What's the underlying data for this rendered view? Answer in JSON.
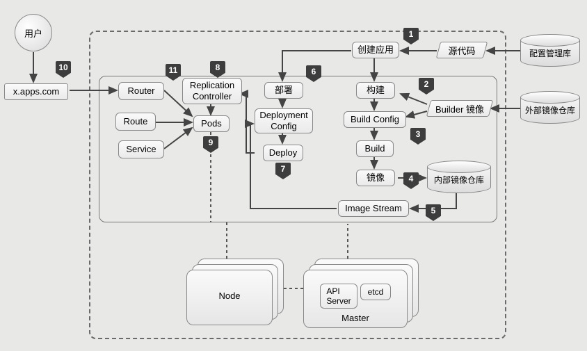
{
  "user": {
    "label": "用户"
  },
  "url_box": "x.apps.com",
  "router": "Router",
  "route": "Route",
  "service": "Service",
  "rc": "Replication\nController",
  "pods": "Pods",
  "deploy_header": "部署",
  "deployment_config": "Deployment\nConfig",
  "deploy": "Deploy",
  "create_app": "创建应用",
  "build_header": "构建",
  "build_config": "Build Config",
  "build": "Build",
  "image": "镜像",
  "image_stream": "Image Stream",
  "source_code": "源代码",
  "builder_image": "Builder 镜像",
  "external_cyl": "配置管理库",
  "external_registry": "外部镜像仓库",
  "internal_registry": "内部镜像仓库",
  "node": "Node",
  "master": "Master",
  "api_server": "API\nServer",
  "etcd": "etcd",
  "badges": {
    "1": "1",
    "2": "2",
    "3": "3",
    "4": "4",
    "5": "5",
    "6": "6",
    "7": "7",
    "8": "8",
    "9": "9",
    "10": "10",
    "11": "11"
  }
}
